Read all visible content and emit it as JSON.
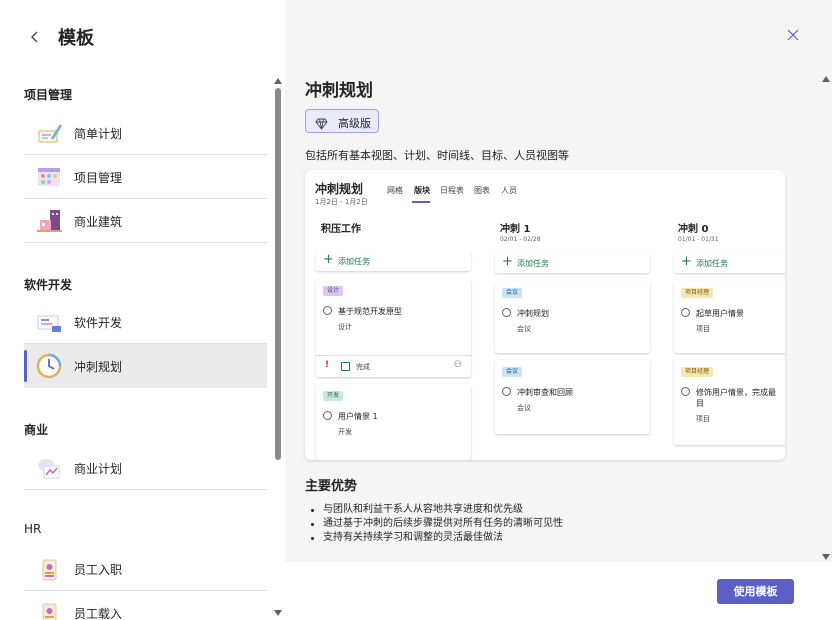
{
  "left": {
    "title": "模板",
    "sections": {
      "project": "项目管理",
      "software": "软件开发",
      "business": "商业",
      "hr": "HR"
    },
    "items": {
      "simple_plan": "简单计划",
      "project_mgmt": "项目管理",
      "commercial_building": "商业建筑",
      "software_dev": "软件开发",
      "sprint_plan": "冲刺规划",
      "business_plan": "商业计划",
      "onboarding": "员工入职",
      "employee_loading": "员工载入"
    }
  },
  "detail": {
    "title": "冲刺规划",
    "badge": "高级版",
    "description": "包括所有基本视图、计划、时间线、目标、人员视图等",
    "preview": {
      "title": "冲刺规划",
      "date": "1月2日 - 1月2日",
      "tabs": [
        "网格",
        "版块",
        "日程表",
        "图表",
        "人员"
      ],
      "columns": [
        {
          "title": "积压工作",
          "sub": ""
        },
        {
          "title": "冲刺 1",
          "sub": "02/01 - 02/28"
        },
        {
          "title": "冲刺 0",
          "sub": "01/01 - 01/31"
        }
      ],
      "add_task": "添加任务",
      "cards": {
        "c1": {
          "tag": "设计",
          "title": "基于规范开发原型",
          "sub": "设计",
          "status": "完成"
        },
        "c2": {
          "tag": "开发",
          "title": "用户情景 1",
          "sub": "开发"
        },
        "c3": {
          "tag": "会议",
          "title": "冲刺规划",
          "sub": "会议"
        },
        "c4": {
          "tag": "会议",
          "title": "冲刺审查和回顾",
          "sub": "会议"
        },
        "c5": {
          "tag": "项目经理",
          "title": "起草用户情景",
          "sub": "项目"
        },
        "c6": {
          "tag": "项目经理",
          "title": "修饰用户情景，完成最",
          "title2": "目",
          "sub": "项目"
        }
      }
    },
    "advantages_title": "主要优势",
    "advantages": [
      "与团队和利益干系人从容地共享进度和优先级",
      "通过基于冲刺的后续步骤提供对所有任务的清晰可见性",
      "支持有关持续学习和调整的灵活最佳做法"
    ],
    "use_button": "使用模板"
  },
  "colors": {
    "accent": "#5b5fc7",
    "green": "#237b4b"
  }
}
